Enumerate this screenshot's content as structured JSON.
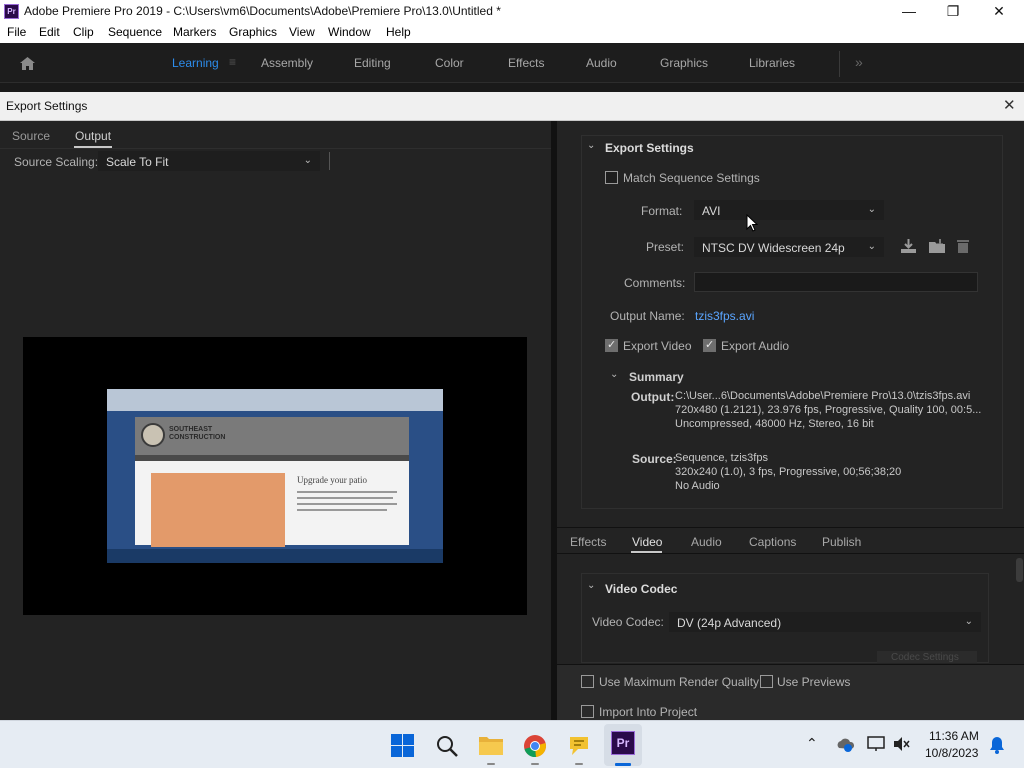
{
  "window": {
    "title": "Adobe Premiere Pro 2019 - C:\\Users\\vm6\\Documents\\Adobe\\Premiere Pro\\13.0\\Untitled *",
    "logo_text": "Pr"
  },
  "menu": [
    "File",
    "Edit",
    "Clip",
    "Sequence",
    "Markers",
    "Graphics",
    "View",
    "Window",
    "Help"
  ],
  "workspaces": [
    "Learning",
    "Assembly",
    "Editing",
    "Color",
    "Effects",
    "Audio",
    "Graphics",
    "Libraries"
  ],
  "dialog": {
    "title": "Export Settings",
    "left_tabs": [
      "Source",
      "Output"
    ],
    "source_scaling_label": "Source Scaling:",
    "source_scaling_value": "Scale To Fit",
    "preview": {
      "logo_line1": "SOUTHEAST",
      "logo_line2": "CONSTRUCTION",
      "heading": "Upgrade your patio"
    }
  },
  "export_settings": {
    "header": "Export Settings",
    "match_sequence": "Match Sequence Settings",
    "format_label": "Format:",
    "format_value": "AVI",
    "preset_label": "Preset:",
    "preset_value": "NTSC DV Widescreen 24p",
    "comments_label": "Comments:",
    "output_name_label": "Output Name:",
    "output_name_value": "tzis3fps.avi",
    "export_video": "Export Video",
    "export_audio": "Export Audio",
    "summary": {
      "header": "Summary",
      "output_label": "Output:",
      "output_lines": [
        "C:\\User...6\\Documents\\Adobe\\Premiere Pro\\13.0\\tzis3fps.avi",
        "720x480 (1.2121), 23.976 fps, Progressive, Quality 100, 00:5...",
        "Uncompressed, 48000 Hz, Stereo, 16 bit"
      ],
      "source_label": "Source:",
      "source_lines": [
        "Sequence, tzis3fps",
        "320x240 (1.0), 3 fps, Progressive, 00;56;38;20",
        "No Audio"
      ]
    }
  },
  "lower_tabs": [
    "Effects",
    "Video",
    "Audio",
    "Captions",
    "Publish"
  ],
  "video_codec": {
    "header": "Video Codec",
    "label": "Video Codec:",
    "value": "DV (24p Advanced)",
    "codec_settings": "Codec Settings"
  },
  "bottom_options": {
    "max_render": "Use Maximum Render Quality",
    "use_previews": "Use Previews",
    "import_project": "Import Into Project"
  },
  "taskbar": {
    "time": "11:36 AM",
    "date": "10/8/2023"
  },
  "colors": {
    "accent": "#2d8ceb",
    "link": "#5aa5ff",
    "panel": "#232323"
  }
}
